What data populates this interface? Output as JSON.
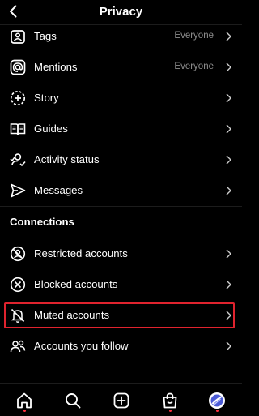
{
  "header": {
    "title": "Privacy",
    "back_icon": "chevron-left-icon"
  },
  "rows": [
    {
      "label": "Tags",
      "value": "Everyone",
      "icon": "tag-icon"
    },
    {
      "label": "Mentions",
      "value": "Everyone",
      "icon": "at-sign-icon"
    },
    {
      "label": "Story",
      "value": "",
      "icon": "story-plus-icon"
    },
    {
      "label": "Guides",
      "value": "",
      "icon": "book-icon"
    },
    {
      "label": "Activity status",
      "value": "",
      "icon": "person-activity-icon"
    },
    {
      "label": "Messages",
      "value": "",
      "icon": "paper-plane-icon"
    }
  ],
  "connections": {
    "heading": "Connections",
    "rows": [
      {
        "label": "Restricted accounts",
        "icon": "restricted-icon"
      },
      {
        "label": "Blocked accounts",
        "icon": "blocked-x-icon"
      },
      {
        "label": "Muted accounts",
        "icon": "muted-bell-icon",
        "highlighted": true
      },
      {
        "label": "Accounts you follow",
        "icon": "people-icon"
      }
    ]
  },
  "highlight_color": "#e0232e",
  "tabbar": [
    "home-icon",
    "search-icon",
    "create-icon",
    "shop-icon",
    "profile-icon"
  ]
}
